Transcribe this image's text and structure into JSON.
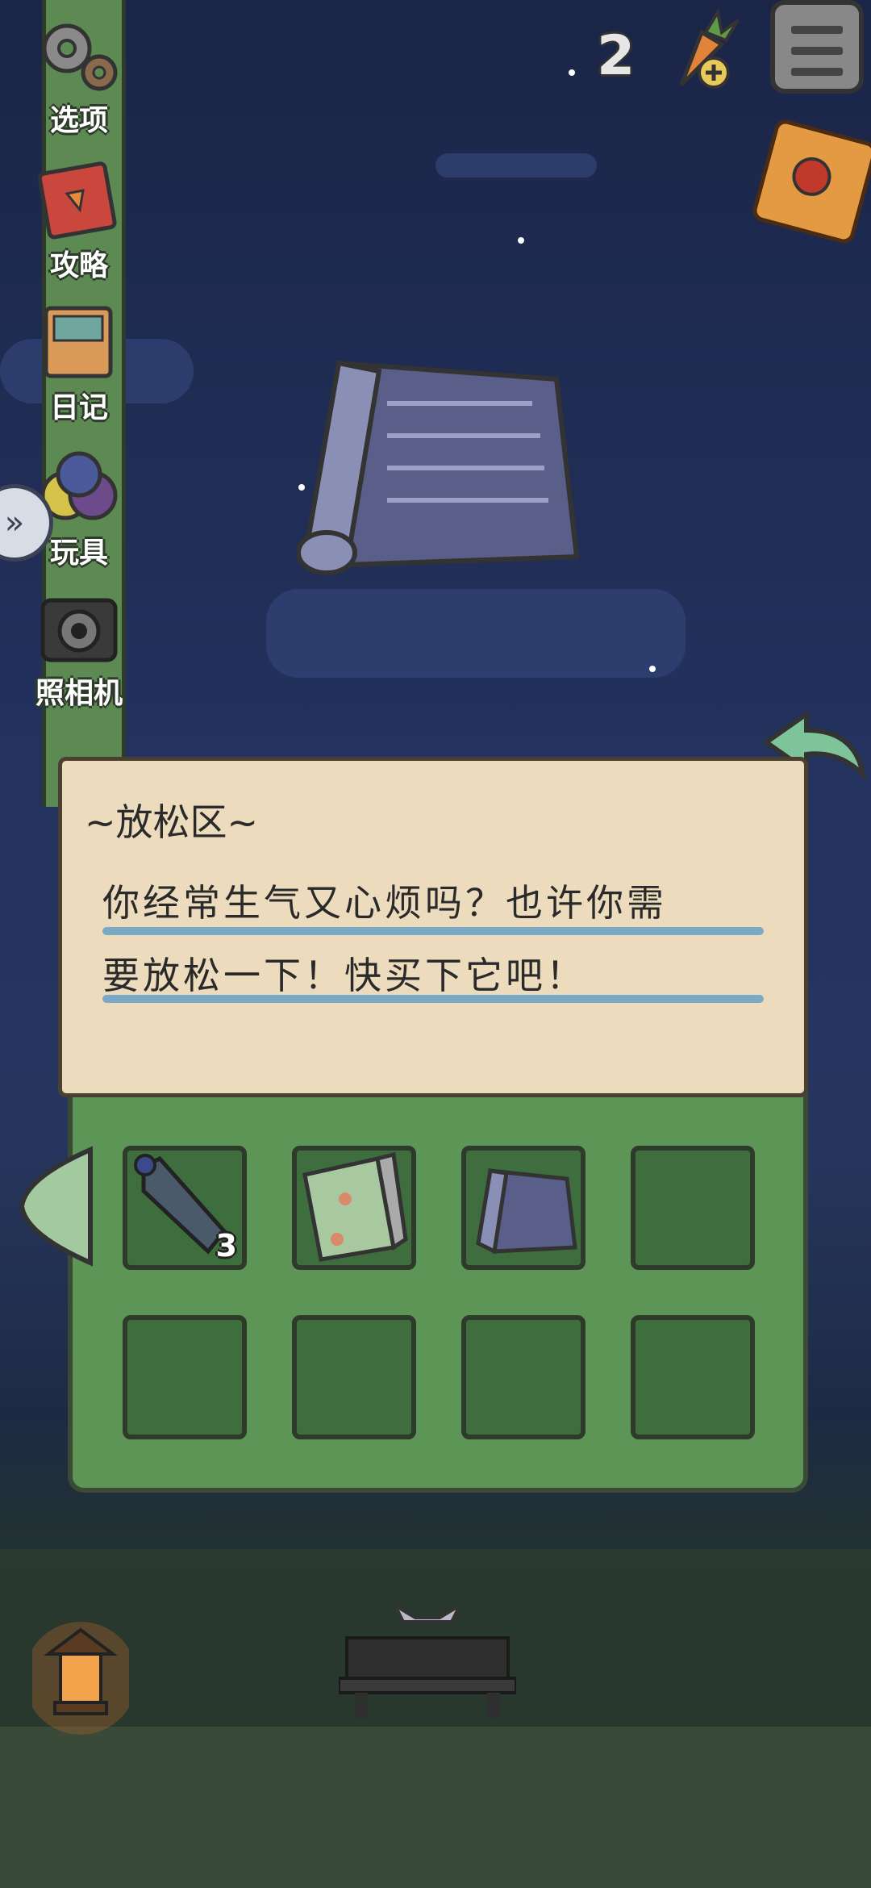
{
  "sidebar": {
    "items": [
      {
        "label": "选项",
        "icon": "gear-icon"
      },
      {
        "label": "攻略",
        "icon": "guide-book-icon"
      },
      {
        "label": "日记",
        "icon": "diary-icon"
      },
      {
        "label": "玩具",
        "icon": "toy-balls-icon"
      },
      {
        "label": "照相机",
        "icon": "camera-icon"
      }
    ]
  },
  "header": {
    "carrot_count": "2"
  },
  "info_panel": {
    "title": "~放松区~",
    "lines": [
      "你经常生气又心烦吗？也许你需",
      "要放松一下！快买下它吧！"
    ]
  },
  "inventory": {
    "slots": [
      {
        "item": "plastic-bottle",
        "count": "3"
      },
      {
        "item": "picnic-mat-green",
        "count": ""
      },
      {
        "item": "rolled-mat-blue",
        "count": ""
      },
      {
        "item": "",
        "count": ""
      },
      {
        "item": "",
        "count": ""
      },
      {
        "item": "",
        "count": ""
      },
      {
        "item": "",
        "count": ""
      },
      {
        "item": "",
        "count": ""
      }
    ]
  },
  "colors": {
    "panel_bg": "#ecdcbd",
    "inventory_bg": "#5c9555",
    "slot_bg": "#3f6e3e",
    "rule_blue": "#7aa9c6",
    "sky": "#23325e"
  }
}
